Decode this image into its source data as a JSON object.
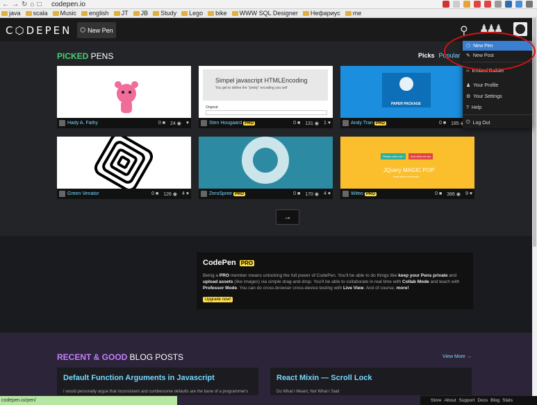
{
  "browser": {
    "url": "codepen.io",
    "bookmarks": [
      "java",
      "scala",
      "Music",
      "english",
      "JT",
      "JB",
      "Study",
      "Lego",
      "bike",
      "WWW SQL Designer",
      "Нефариус",
      "me"
    ]
  },
  "header": {
    "logo": "C⬡DEPEN",
    "new_pen": "New Pen"
  },
  "picked": {
    "title_accent": "PICKED",
    "title_rest": " PENS",
    "tabs": [
      "Picks",
      "Popular",
      "Re"
    ]
  },
  "cards": [
    {
      "author": "Hady A. Fathy",
      "pro": "",
      "stats": [
        "0",
        "24",
        "",
        ""
      ],
      "thumb_color": "#ffffff"
    },
    {
      "author": "Sten Hougaard",
      "pro": "PRO",
      "stats": [
        "0",
        "131",
        "1",
        ""
      ],
      "thumb_color": "#ffffff",
      "thumb_title": "Simpel javascript HTMLEncoding",
      "thumb_sub": "You get to define the \"pretty\" encoding you self",
      "thumb_label": "Original:"
    },
    {
      "author": "Andy Tran",
      "pro": "PRO",
      "stats": [
        "0",
        "185",
        ""
      ],
      "thumb_color": "#1b8ede",
      "thumb_title": "PAPER PACKAGE"
    },
    {
      "author": "Green Venator",
      "pro": "",
      "stats": [
        "0",
        "126",
        "4"
      ],
      "thumb_color": "#ffffff"
    },
    {
      "author": "ZeroSpree",
      "pro": "PRO",
      "stats": [
        "0",
        "170",
        "4"
      ],
      "thumb_color": "#2c8ba3"
    },
    {
      "author": "Wifeo",
      "pro": "PRO",
      "stats": [
        "0",
        "386",
        "9"
      ],
      "thumb_color": "#fbbf2d",
      "thumb_title": "JQuery MAGIC POP",
      "thumb_sub": "www.wifeo.com/code",
      "btn1": "Please click me !",
      "btn2": "And click me too"
    }
  ],
  "next_label": "→",
  "pro": {
    "title": "CodePen",
    "badge": "PRO",
    "text_parts": [
      "Being a ",
      "PRO",
      " member means unlocking the full power of CodePen. You'll be able to do things like ",
      "keep your Pens private",
      " and ",
      "upload assets",
      " (like images) via simple drag-and-drop. You'll be able to collaborate in real time with ",
      "Collab Mode",
      " and teach with ",
      "Professor Mode",
      ". You can do cross-browser cross-device testing with ",
      "Live View",
      ". And of course, ",
      "more!"
    ],
    "upgrade": "Upgrade now!"
  },
  "blog": {
    "title_accent": "RECENT & GOOD",
    "title_rest": " BLOG POSTS",
    "view_more": "View More →",
    "posts": [
      {
        "title": "Default Function Arguments in Javascript",
        "text": "I would personally argue that inconsistent and cumbersome defaults are the bane of a programmer's"
      },
      {
        "title": "React Mixin — Scroll Lock",
        "text": "Do What I Meant, Not What I Said"
      }
    ]
  },
  "status": "codepen.io/pen/",
  "footer": [
    "Store",
    "About",
    "Support",
    "Docs",
    "Blog",
    "Stats"
  ],
  "dropdown": [
    {
      "label": "New Pen",
      "highlighted": true
    },
    {
      "label": "New Post",
      "highlighted": false
    },
    {
      "label": "Embed Builder",
      "highlighted": false
    },
    {
      "label": "Your Profile",
      "highlighted": false
    },
    {
      "label": "Your Settings",
      "highlighted": false
    },
    {
      "label": "Help",
      "highlighted": false
    },
    {
      "label": "Log Out",
      "highlighted": false
    }
  ]
}
